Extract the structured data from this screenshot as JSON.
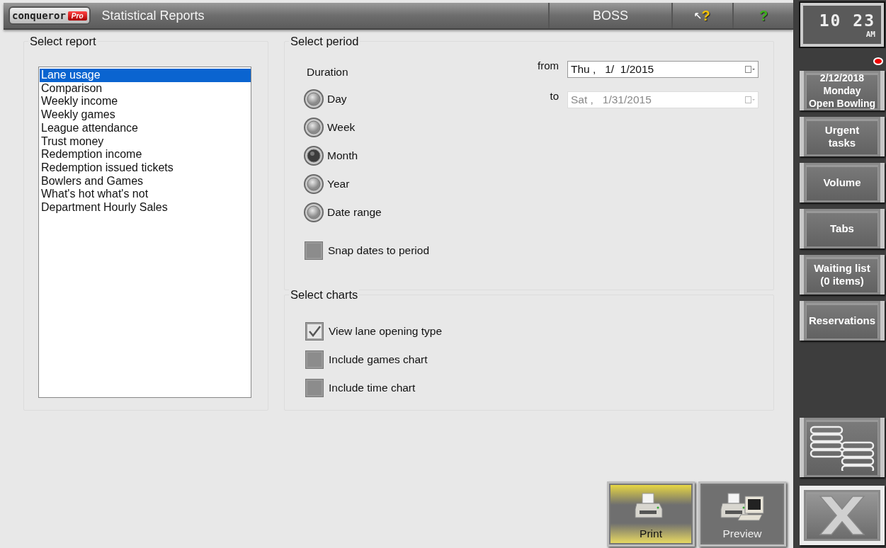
{
  "title_bar": {
    "logo": "conqueror",
    "logo_badge": "Pro",
    "title": "Statistical Reports",
    "user": "BOSS",
    "context_help": "?",
    "help": "?"
  },
  "report": {
    "heading": "Select report",
    "items": [
      {
        "label": "Lane usage",
        "selected": true
      },
      {
        "label": "Comparison",
        "selected": false
      },
      {
        "label": "Weekly income",
        "selected": false
      },
      {
        "label": "Weekly games",
        "selected": false
      },
      {
        "label": "League attendance",
        "selected": false
      },
      {
        "label": "Trust money",
        "selected": false
      },
      {
        "label": "Redemption income",
        "selected": false
      },
      {
        "label": "Redemption issued tickets",
        "selected": false
      },
      {
        "label": "Bowlers and Games",
        "selected": false
      },
      {
        "label": "What's hot what's not",
        "selected": false
      },
      {
        "label": "Department Hourly Sales",
        "selected": false
      }
    ]
  },
  "period": {
    "heading": "Select period",
    "duration_label": "Duration",
    "durations": [
      {
        "label": "Day",
        "selected": false
      },
      {
        "label": "Week",
        "selected": false
      },
      {
        "label": "Month",
        "selected": true
      },
      {
        "label": "Year",
        "selected": false
      },
      {
        "label": "Date range",
        "selected": false
      }
    ],
    "snap": {
      "label": "Snap dates to period",
      "checked": false
    },
    "from": {
      "label": "from",
      "value": "Thu ,   1/  1/2015",
      "disabled": false
    },
    "to": {
      "label": "to",
      "value": "Sat ,   1/31/2015",
      "disabled": true
    }
  },
  "charts": {
    "heading": "Select charts",
    "options": [
      {
        "label": "View lane opening type",
        "checked": true
      },
      {
        "label": "Include games chart",
        "checked": false
      },
      {
        "label": "Include time chart",
        "checked": false
      }
    ]
  },
  "actions": [
    {
      "label": "Print",
      "kind": "print",
      "highlighted": true
    },
    {
      "label": "Preview",
      "kind": "preview",
      "highlighted": false
    }
  ],
  "sidebar": {
    "clock": {
      "time": "10 23",
      "meridiem": "AM"
    },
    "alert": true,
    "buttons": [
      {
        "kind": "text",
        "label": "2/12/2018\nMonday\nOpen Bowling"
      },
      {
        "kind": "text",
        "label": "Urgent\ntasks"
      },
      {
        "kind": "text",
        "label": "Volume"
      },
      {
        "kind": "text",
        "label": "Tabs"
      },
      {
        "kind": "text",
        "label": "Waiting list\n(0 items)"
      },
      {
        "kind": "text",
        "label": "Reservations"
      },
      {
        "kind": "lanes"
      },
      {
        "kind": "close"
      }
    ]
  }
}
